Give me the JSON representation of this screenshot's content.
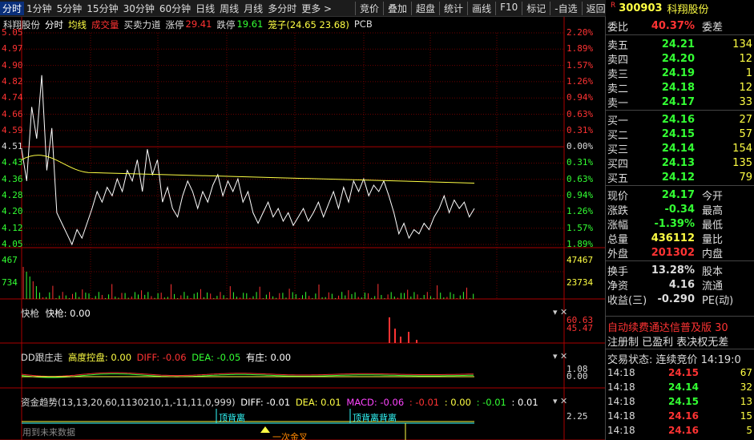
{
  "toolbar": {
    "periods": [
      "分时",
      "1分钟",
      "5分钟",
      "15分钟",
      "30分钟",
      "60分钟",
      "日线",
      "周线",
      "月线",
      "多分时",
      "更多 >"
    ],
    "functions": [
      "竞价",
      "叠加",
      "超盘",
      "统计",
      "画线",
      "F10",
      "标记",
      "-自选",
      "返回"
    ]
  },
  "stock": {
    "code": "300903",
    "name": "科翔股份"
  },
  "legend": {
    "stock_name": "科翔股份",
    "mode": "分时",
    "avg_line": "均线",
    "volume": "成交量",
    "force": "买卖力道",
    "limit_up_label": "涨停",
    "limit_up": "29.41",
    "limit_down_label": "跌停",
    "limit_down": "19.61",
    "cage": "笼子(24.65 23.68)",
    "sector": "PCB"
  },
  "price_axis_left": [
    "5.05",
    "4.97",
    "4.90",
    "4.82",
    "4.74",
    "4.66",
    "4.59",
    "4.51",
    "4.43",
    "4.36",
    "4.28",
    "4.20",
    "4.12",
    "4.05"
  ],
  "pct_axis_right": [
    "2.20%",
    "1.89%",
    "1.57%",
    "1.26%",
    "0.94%",
    "0.63%",
    "0.31%",
    "0.00%",
    "0.31%",
    "0.63%",
    "0.94%",
    "1.26%",
    "1.57%",
    "1.89%"
  ],
  "volume_axis": {
    "left_top": "467",
    "left_mid": "734",
    "right_top": "47467",
    "right_mid": "23734"
  },
  "ind1": {
    "name": "快枪",
    "line": "快枪: 0.00",
    "axis_top": "60.63",
    "axis_mid": "45.47"
  },
  "ind2": {
    "name": "DD跟庄走",
    "hl_label": "高度控盘: 0.00",
    "diff": "DIFF: -0.06",
    "dea": "DEA: -0.05",
    "zz": "有庄: 0.00",
    "axis_a": "1.08",
    "axis_b": "0.00"
  },
  "ind3": {
    "name": "资金趋势(13,13,20,60,1130210,1,-11,11,0,999)",
    "diff": "DIFF: -0.01",
    "dea": "DEA: 0.01",
    "macd": "MACD: -0.06",
    "v1": ": -0.01",
    "v2": ": 0.00",
    "v3": ": -0.01",
    "v4": ": 0.01",
    "axis": "2.25",
    "tag1": "顶背离",
    "tag2": "顶背离背离",
    "tag3": "一次金叉",
    "future": "用到未来数据"
  },
  "quote": {
    "weibi_label": "委比",
    "weibi": "40.37%",
    "weicha_label": "委差",
    "sells": [
      {
        "label": "卖五",
        "price": "24.21",
        "vol": "134"
      },
      {
        "label": "卖四",
        "price": "24.20",
        "vol": "12"
      },
      {
        "label": "卖三",
        "price": "24.19",
        "vol": "1"
      },
      {
        "label": "卖二",
        "price": "24.18",
        "vol": "12"
      },
      {
        "label": "卖一",
        "price": "24.17",
        "vol": "33"
      }
    ],
    "buys": [
      {
        "label": "买一",
        "price": "24.16",
        "vol": "27"
      },
      {
        "label": "买二",
        "price": "24.15",
        "vol": "57"
      },
      {
        "label": "买三",
        "price": "24.14",
        "vol": "154"
      },
      {
        "label": "买四",
        "price": "24.13",
        "vol": "135"
      },
      {
        "label": "买五",
        "price": "24.12",
        "vol": "79"
      }
    ],
    "stats": [
      {
        "k": "现价",
        "v": "24.17",
        "k2": "今开"
      },
      {
        "k": "涨跌",
        "v": "-0.34",
        "k2": "最高"
      },
      {
        "k": "涨幅",
        "v": "-1.39%",
        "k2": "最低"
      },
      {
        "k": "总量",
        "v": "436112",
        "k2": "量比"
      },
      {
        "k": "外盘",
        "v": "201302",
        "k2": "内盘"
      }
    ],
    "stats2": [
      {
        "k": "换手",
        "v": "13.28%",
        "k2": "股本"
      },
      {
        "k": "净资",
        "v": "4.16",
        "k2": "流通"
      },
      {
        "k": "收益(三)",
        "v": "-0.290",
        "k2": "PE(动)"
      }
    ],
    "notice1": "自动续费通达信普及版 30",
    "notice2": "注册制 已盈利 表决权无差",
    "trade_status": "交易状态: 连续竞价 14:19:0",
    "trades": [
      {
        "t": "14:18",
        "p": "24.15",
        "n": "67"
      },
      {
        "t": "14:18",
        "p": "24.14",
        "n": "32"
      },
      {
        "t": "14:18",
        "p": "24.15",
        "n": "13"
      },
      {
        "t": "14:18",
        "p": "24.16",
        "n": "15"
      },
      {
        "t": "14:18",
        "p": "24.16",
        "n": "5"
      }
    ]
  },
  "colors": {
    "up": "#ff3333",
    "down": "#33ff33",
    "yellow": "#ffff44",
    "white": "#ffffff",
    "cyan": "#33ffff",
    "magenta": "#ff44ff",
    "grid": "#8b0000"
  }
}
